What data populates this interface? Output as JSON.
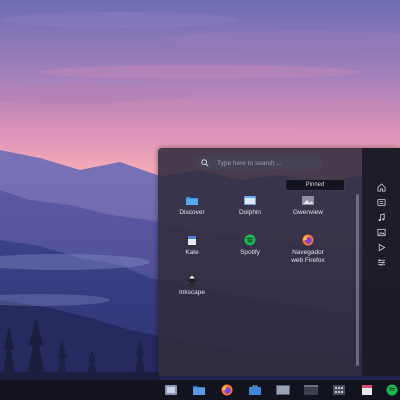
{
  "launcher": {
    "search": {
      "placeholder": "Type here to search ...",
      "value": ""
    },
    "active_tab": "Pinned",
    "apps": [
      {
        "label": "Discover",
        "icon": "discover-icon"
      },
      {
        "label": "Dolphin",
        "icon": "dolphin-icon"
      },
      {
        "label": "Gwenview",
        "icon": "gwenview-icon"
      },
      {
        "label": "Kate",
        "icon": "kate-icon"
      },
      {
        "label": "Spotify",
        "icon": "spotify-icon"
      },
      {
        "label": "Navegador web Firefox",
        "icon": "firefox-icon"
      },
      {
        "label": "Inkscape",
        "icon": "inkscape-icon"
      }
    ],
    "sidebar_icons": [
      "home-icon",
      "documents-icon",
      "music-icon",
      "pictures-icon",
      "videos-icon",
      "settings-icon"
    ]
  },
  "taskbar": {
    "items": [
      "app-launcher-icon",
      "file-manager-icon",
      "firefox-icon",
      "store-icon",
      "terminal-icon",
      "window-icon",
      "grid-icon",
      "calendar-icon",
      "spotify-icon"
    ]
  },
  "colors": {
    "accent_blue": "#4a90e2",
    "spotify_green": "#1db954",
    "firefox_orange": "#ff7139",
    "launcher_bg": "#302c3c",
    "taskbar_bg": "#12121a"
  }
}
